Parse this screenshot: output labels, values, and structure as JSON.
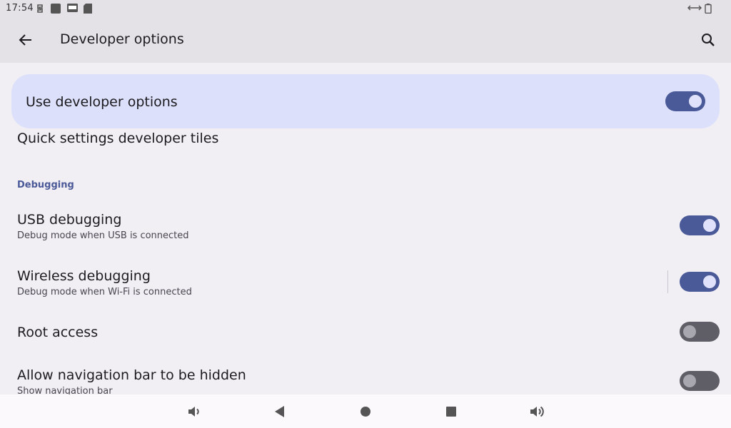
{
  "status_bar": {
    "time": "17:54",
    "icons": [
      "sync-icon",
      "square-notification-icon",
      "dvr-icon",
      "sd-card-icon",
      "ethernet-icon",
      "battery-icon"
    ]
  },
  "toolbar": {
    "title": "Developer options",
    "back_icon": "arrow-left-icon",
    "search_icon": "search-icon"
  },
  "main_switch": {
    "label": "Use developer options",
    "enabled": true
  },
  "partial_item": {
    "title": "Quick settings developer tiles"
  },
  "sections": [
    {
      "header": "Debugging",
      "items": [
        {
          "title": "USB debugging",
          "summary": "Debug mode when USB is connected",
          "enabled": true
        },
        {
          "title": "Wireless debugging",
          "summary": "Debug mode when Wi-Fi is connected",
          "enabled": true
        },
        {
          "title": "Root access",
          "summary": "",
          "enabled": false
        },
        {
          "title": "Allow navigation bar to be hidden",
          "summary": "Show navigation bar",
          "enabled": false
        }
      ]
    }
  ],
  "nav_bar": {
    "buttons": [
      "volume-down-icon",
      "back-triangle-icon",
      "home-circle-icon",
      "recents-square-icon",
      "volume-up-icon"
    ]
  },
  "colors": {
    "accent": "#4a5998",
    "main_switch_bg": "#dde0fa",
    "toggle_off": "#5f5d66",
    "background": "#f2eff4"
  }
}
